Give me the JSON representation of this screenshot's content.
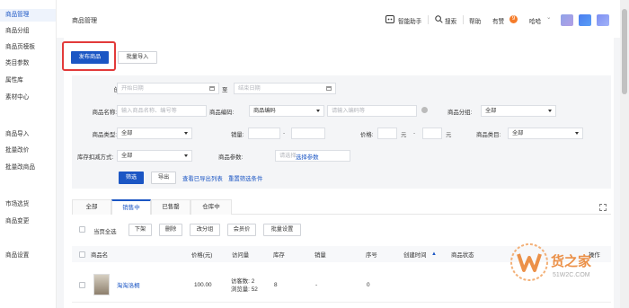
{
  "sidebar": {
    "items": [
      {
        "label": "商品管理",
        "active": true
      },
      {
        "label": "商品分组"
      },
      {
        "label": "商品页模板"
      },
      {
        "label": "类目参数"
      },
      {
        "label": "属性库"
      },
      {
        "label": "素材中心"
      },
      {
        "label": "商品导入"
      },
      {
        "label": "批量改价"
      },
      {
        "label": "批量改商品"
      },
      {
        "label": "市场选货"
      },
      {
        "label": "商品变更"
      },
      {
        "label": "商品设置"
      }
    ]
  },
  "header": {
    "title": "商品管理",
    "assistant": "智能助手",
    "search": "搜索",
    "help": "帮助",
    "inbox": "有赞",
    "inbox_badge": "9",
    "user": "哈哈",
    "chevron": "⌄"
  },
  "actions": {
    "publish": "发布商品",
    "batch_import": "批量导入"
  },
  "filter": {
    "created_label": "创建时间:",
    "start_ph": "开始日期",
    "to": "至",
    "end_ph": "结束日期",
    "name_label": "商品名称:",
    "name_ph": "输入商品名称、编号等",
    "code_type_label": "商品编码",
    "code_ph": "请输入编码等",
    "group_label": "商品分组:",
    "group_val": "全部",
    "type_label": "商品类型:",
    "type_val": "全部",
    "sales_label": "销量:",
    "dash": "-",
    "price_label": "价格:",
    "unit": "元",
    "category_label": "商品类目:",
    "category_val": "全部",
    "stock_label": "库存扣减方式:",
    "stock_val": "全部",
    "param_label": "商品参数:",
    "param_ph": "请选择",
    "param_link": "选择参数",
    "filter_btn": "筛选",
    "export_btn": "导出",
    "view_export": "查看已导出列表",
    "reset": "重置筛选条件"
  },
  "tabs": [
    {
      "label": "全部"
    },
    {
      "label": "销售中",
      "active": true
    },
    {
      "label": "已售罄"
    },
    {
      "label": "仓库中"
    }
  ],
  "bulk": {
    "select_page": "当页全选",
    "off_shelf": "下架",
    "delete": "删除",
    "change_group": "改分组",
    "member_price": "会员价",
    "batch_set": "批量设置"
  },
  "table": {
    "headers": [
      "商品名",
      "价格(元)",
      "访问量",
      "库存",
      "销量",
      "序号",
      "创建时间",
      "商品状态",
      "操作"
    ],
    "rows": [
      {
        "name": "淘淘洛桐",
        "price": "100.00",
        "visitors": "访客数: 2",
        "views": "浏览量: 52",
        "stock": "8",
        "sales": "-",
        "seq": "0"
      }
    ]
  },
  "watermark": {
    "brand": "货之家",
    "url": "51W2C.COM"
  },
  "colors": {
    "primary": "#1b56c4",
    "highlight": "#e23a3a",
    "badge": "#f57c2a"
  },
  "icons": [
    "robot-icon",
    "search-icon",
    "calendar-icon",
    "help-circle-icon",
    "expand-icon",
    "sort-icon"
  ]
}
